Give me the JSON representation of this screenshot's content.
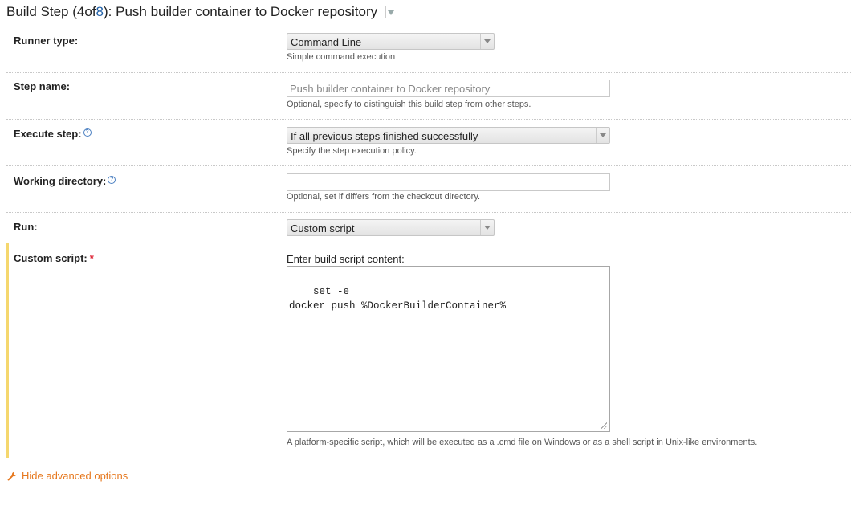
{
  "header": {
    "prefix": "Build Step (",
    "step_index": "4",
    "of_text": " of ",
    "step_total": "8",
    "suffix": "): Push builder container to Docker repository"
  },
  "fields": {
    "runner_type": {
      "label": "Runner type:",
      "value": "Command Line",
      "hint": "Simple command execution"
    },
    "step_name": {
      "label": "Step name:",
      "value": "Push builder container to Docker repository",
      "hint": "Optional, specify to distinguish this build step from other steps."
    },
    "execute_step": {
      "label": "Execute step:",
      "value": "If all previous steps finished successfully",
      "hint": "Specify the step execution policy."
    },
    "working_directory": {
      "label": "Working directory:",
      "value": "",
      "hint": "Optional, set if differs from the checkout directory."
    },
    "run": {
      "label": "Run:",
      "value": "Custom script"
    },
    "custom_script": {
      "label": "Custom script:",
      "required_mark": "*",
      "content_label": "Enter build script content:",
      "content": "set -e\ndocker push %DockerBuilderContainer%",
      "hint": "A platform-specific script, which will be executed as a .cmd file on Windows or as a shell script in Unix-like environments."
    }
  },
  "advanced_toggle": {
    "label": "Hide advanced options"
  },
  "icons": {
    "help": "question-icon",
    "wrench": "wrench-icon",
    "dropdown": "chevron-down-icon"
  },
  "colors": {
    "link": "#1f5fa6",
    "advanced": "#e6781e",
    "required_bar": "#f5d76e",
    "required_mark": "#d23"
  }
}
